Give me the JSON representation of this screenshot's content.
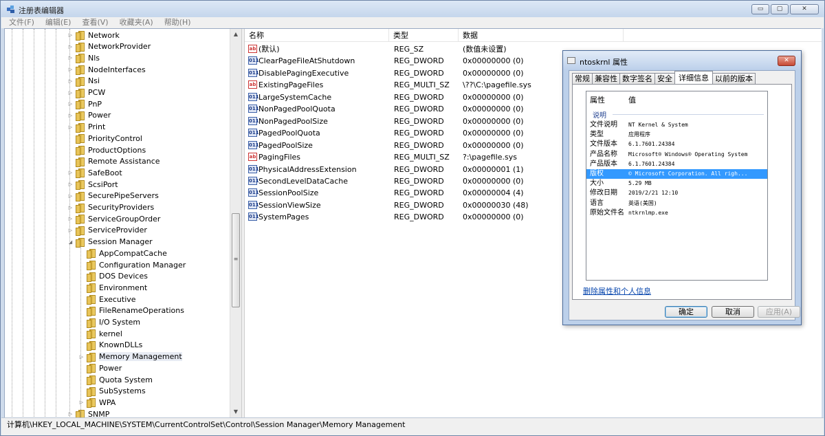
{
  "window": {
    "title": "注册表编辑器",
    "buttons": {
      "minimize": "▭",
      "maximize": "▢",
      "close": "✕"
    }
  },
  "menu": [
    "文件(F)",
    "编辑(E)",
    "查看(V)",
    "收藏夹(A)",
    "帮助(H)"
  ],
  "tree": {
    "items": [
      {
        "label": "Network",
        "level": 0,
        "expander": "▷"
      },
      {
        "label": "NetworkProvider",
        "level": 0,
        "expander": "▷"
      },
      {
        "label": "Nls",
        "level": 0,
        "expander": "▷"
      },
      {
        "label": "NodeInterfaces",
        "level": 0,
        "expander": "▷"
      },
      {
        "label": "Nsi",
        "level": 0,
        "expander": "▷"
      },
      {
        "label": "PCW",
        "level": 0,
        "expander": "▷"
      },
      {
        "label": "PnP",
        "level": 0,
        "expander": "▷"
      },
      {
        "label": "Power",
        "level": 0,
        "expander": "▷"
      },
      {
        "label": "Print",
        "level": 0,
        "expander": "▷"
      },
      {
        "label": "PriorityControl",
        "level": 0,
        "expander": ""
      },
      {
        "label": "ProductOptions",
        "level": 0,
        "expander": ""
      },
      {
        "label": "Remote Assistance",
        "level": 0,
        "expander": ""
      },
      {
        "label": "SafeBoot",
        "level": 0,
        "expander": "▷"
      },
      {
        "label": "ScsiPort",
        "level": 0,
        "expander": "▷"
      },
      {
        "label": "SecurePipeServers",
        "level": 0,
        "expander": "▷"
      },
      {
        "label": "SecurityProviders",
        "level": 0,
        "expander": "▷"
      },
      {
        "label": "ServiceGroupOrder",
        "level": 0,
        "expander": "▷"
      },
      {
        "label": "ServiceProvider",
        "level": 0,
        "expander": "▷"
      },
      {
        "label": "Session Manager",
        "level": 0,
        "expander": "◢"
      },
      {
        "label": "AppCompatCache",
        "level": 1,
        "expander": ""
      },
      {
        "label": "Configuration Manager",
        "level": 1,
        "expander": ""
      },
      {
        "label": "DOS Devices",
        "level": 1,
        "expander": ""
      },
      {
        "label": "Environment",
        "level": 1,
        "expander": ""
      },
      {
        "label": "Executive",
        "level": 1,
        "expander": ""
      },
      {
        "label": "FileRenameOperations",
        "level": 1,
        "expander": ""
      },
      {
        "label": "I/O System",
        "level": 1,
        "expander": ""
      },
      {
        "label": "kernel",
        "level": 1,
        "expander": ""
      },
      {
        "label": "KnownDLLs",
        "level": 1,
        "expander": ""
      },
      {
        "label": "Memory Management",
        "level": 1,
        "expander": "▷",
        "selected": true
      },
      {
        "label": "Power",
        "level": 1,
        "expander": ""
      },
      {
        "label": "Quota System",
        "level": 1,
        "expander": ""
      },
      {
        "label": "SubSystems",
        "level": 1,
        "expander": ""
      },
      {
        "label": "WPA",
        "level": 1,
        "expander": "▷"
      },
      {
        "label": "SNMP",
        "level": 0,
        "expander": "▷"
      }
    ]
  },
  "list": {
    "headers": {
      "name": "名称",
      "type": "类型",
      "data": "数据"
    },
    "rows": [
      {
        "icon": "ab",
        "name": "(默认)",
        "type": "REG_SZ",
        "data": "(数值未设置)"
      },
      {
        "icon": "011",
        "name": "ClearPageFileAtShutdown",
        "type": "REG_DWORD",
        "data": "0x00000000 (0)"
      },
      {
        "icon": "011",
        "name": "DisablePagingExecutive",
        "type": "REG_DWORD",
        "data": "0x00000000 (0)"
      },
      {
        "icon": "ab",
        "name": "ExistingPageFiles",
        "type": "REG_MULTI_SZ",
        "data": "\\??\\C:\\pagefile.sys"
      },
      {
        "icon": "011",
        "name": "LargeSystemCache",
        "type": "REG_DWORD",
        "data": "0x00000000 (0)"
      },
      {
        "icon": "011",
        "name": "NonPagedPoolQuota",
        "type": "REG_DWORD",
        "data": "0x00000000 (0)"
      },
      {
        "icon": "011",
        "name": "NonPagedPoolSize",
        "type": "REG_DWORD",
        "data": "0x00000000 (0)"
      },
      {
        "icon": "011",
        "name": "PagedPoolQuota",
        "type": "REG_DWORD",
        "data": "0x00000000 (0)"
      },
      {
        "icon": "011",
        "name": "PagedPoolSize",
        "type": "REG_DWORD",
        "data": "0x00000000 (0)"
      },
      {
        "icon": "ab",
        "name": "PagingFiles",
        "type": "REG_MULTI_SZ",
        "data": "?:\\pagefile.sys"
      },
      {
        "icon": "011",
        "name": "PhysicalAddressExtension",
        "type": "REG_DWORD",
        "data": "0x00000001 (1)"
      },
      {
        "icon": "011",
        "name": "SecondLevelDataCache",
        "type": "REG_DWORD",
        "data": "0x00000000 (0)"
      },
      {
        "icon": "011",
        "name": "SessionPoolSize",
        "type": "REG_DWORD",
        "data": "0x00000004 (4)"
      },
      {
        "icon": "011",
        "name": "SessionViewSize",
        "type": "REG_DWORD",
        "data": "0x00000030 (48)"
      },
      {
        "icon": "011",
        "name": "SystemPages",
        "type": "REG_DWORD",
        "data": "0x00000000 (0)"
      }
    ]
  },
  "status_path": "计算机\\HKEY_LOCAL_MACHINE\\SYSTEM\\CurrentControlSet\\Control\\Session Manager\\Memory Management",
  "dialog": {
    "title": "ntoskrnl 属性",
    "close": "✕",
    "tabs": [
      "常规",
      "兼容性",
      "数字签名",
      "安全",
      "详细信息",
      "以前的版本"
    ],
    "active_tab": "详细信息",
    "headers": {
      "property": "属性",
      "value": "值"
    },
    "section": "说明",
    "details": [
      {
        "key": "文件说明",
        "value": "NT Kernel & System"
      },
      {
        "key": "类型",
        "value": "应用程序"
      },
      {
        "key": "文件版本",
        "value": "6.1.7601.24384"
      },
      {
        "key": "产品名称",
        "value": "Microsoft® Windows® Operating System"
      },
      {
        "key": "产品版本",
        "value": "6.1.7601.24384"
      },
      {
        "key": "版权",
        "value": "© Microsoft Corporation. All righ...",
        "highlighted": true
      },
      {
        "key": "大小",
        "value": "5.29 MB"
      },
      {
        "key": "修改日期",
        "value": "2019/2/21 12:10"
      },
      {
        "key": "语言",
        "value": "英语(美国)"
      },
      {
        "key": "原始文件名",
        "value": "ntkrnlmp.exe"
      }
    ],
    "link": "删除属性和个人信息",
    "buttons": {
      "ok": "确定",
      "cancel": "取消",
      "apply": "应用(A)"
    }
  }
}
